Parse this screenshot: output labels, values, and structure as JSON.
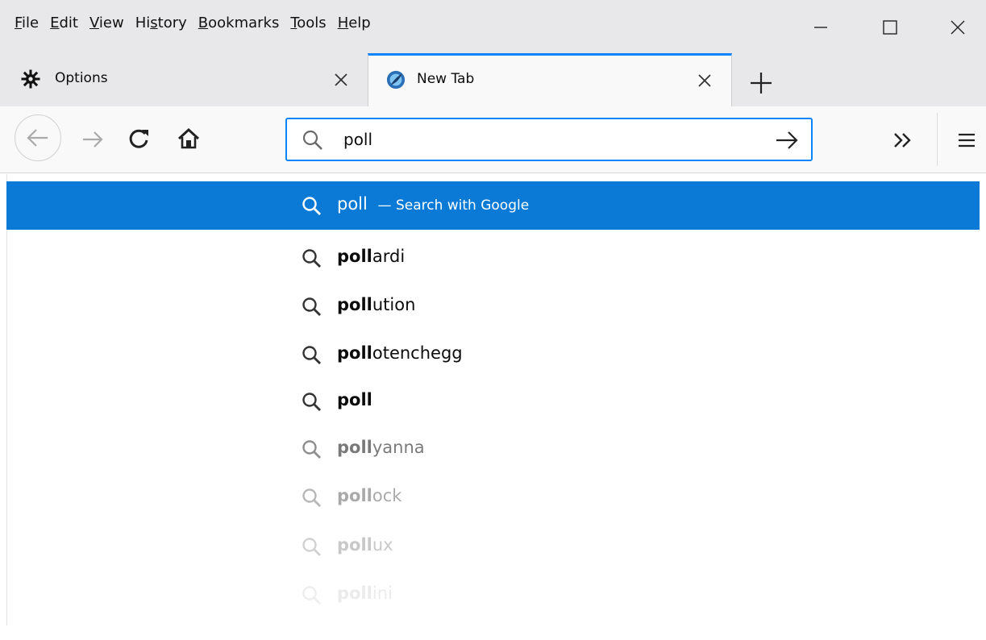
{
  "menubar": {
    "items": [
      {
        "accel": "F",
        "rest": "ile"
      },
      {
        "accel": "E",
        "rest": "dit"
      },
      {
        "accel": "V",
        "rest": "iew"
      },
      {
        "pre": "Hi",
        "accel": "s",
        "rest": "tory"
      },
      {
        "accel": "B",
        "rest": "ookmarks"
      },
      {
        "accel": "T",
        "rest": "ools"
      },
      {
        "accel": "H",
        "rest": "elp"
      }
    ],
    "window_controls": [
      "minimize-icon",
      "maximize-icon",
      "close-icon"
    ]
  },
  "tabs": [
    {
      "label": "Options",
      "icon": "gear-icon",
      "active": false
    },
    {
      "label": "New Tab",
      "icon": "firefox-globe-icon",
      "active": true
    }
  ],
  "navbar": {
    "icons": [
      "back-arrow-icon",
      "forward-arrow-icon",
      "reload-icon",
      "home-icon",
      "overflow-chevron-icon",
      "hamburger-menu-icon"
    ],
    "urlbar": {
      "value": "poll",
      "go_icon": "go-arrow-icon",
      "search_icon": "search-icon"
    }
  },
  "dropdown": {
    "rows": [
      {
        "bold": "poll",
        "rest": "",
        "suffix": "— Search with Google",
        "selected": true
      },
      {
        "bold": "poll",
        "rest": "ardi"
      },
      {
        "bold": "poll",
        "rest": "ution"
      },
      {
        "bold": "poll",
        "rest": "otenchegg"
      },
      {
        "bold": "poll",
        "rest": ""
      },
      {
        "bold": "poll",
        "rest": "yanna"
      },
      {
        "bold": "poll",
        "rest": "ock"
      },
      {
        "bold": "poll",
        "rest": "ux"
      },
      {
        "bold": "poll",
        "rest": "ini"
      }
    ]
  },
  "colors": {
    "accent": "#0a84ff",
    "selected_row": "#0a7ad6",
    "chrome": "#e8e8ea",
    "toolbar": "#f9f9fa"
  }
}
